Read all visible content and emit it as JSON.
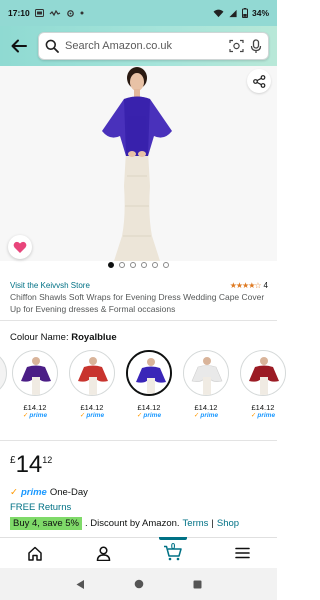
{
  "status_bar": {
    "time": "17:10",
    "battery": "34%"
  },
  "search": {
    "placeholder": "Search Amazon.co.uk"
  },
  "hero": {
    "image_count": 6,
    "active_index": 0
  },
  "product": {
    "store_link": "Visit the Keivvsh Store",
    "rating_stars": 3.5,
    "rating_count": "4",
    "title": "Chiffon Shawls Soft Wraps for Evening Dress Wedding Cape Cover Up for Evening dresses & Formal occasions"
  },
  "colour": {
    "label": "Colour Name:",
    "selected": "Royalblue",
    "swatches": [
      {
        "price": "£14.12",
        "prime": "prime",
        "color": "#4b1e86"
      },
      {
        "price": "£14.12",
        "prime": "prime",
        "color": "#c8342e"
      },
      {
        "price": "£14.12",
        "prime": "prime",
        "color": "#3a26b8"
      },
      {
        "price": "£14.12",
        "prime": "prime",
        "color": "#f2f2f2"
      },
      {
        "price": "£14.12",
        "prime": "prime",
        "color": "#9b1b24"
      }
    ]
  },
  "price": {
    "currency": "£",
    "whole": "14",
    "fraction": "12"
  },
  "delivery": {
    "prime_badge": "prime",
    "one_day": "One-Day",
    "free_returns": "FREE Returns"
  },
  "promo": {
    "tag": "Buy 4, save 5%",
    "text": ". Discount by Amazon.",
    "terms": "Terms",
    "separator": "|",
    "shop": "Shop"
  },
  "bottom_nav": {
    "cart_count": "0"
  },
  "colors": {
    "header_accent": "#92d9d3",
    "link": "#007185",
    "prime_blue": "#1a98ff",
    "star": "#de7921",
    "promo_green": "#7fda69",
    "heart_pink": "#e8457b"
  }
}
